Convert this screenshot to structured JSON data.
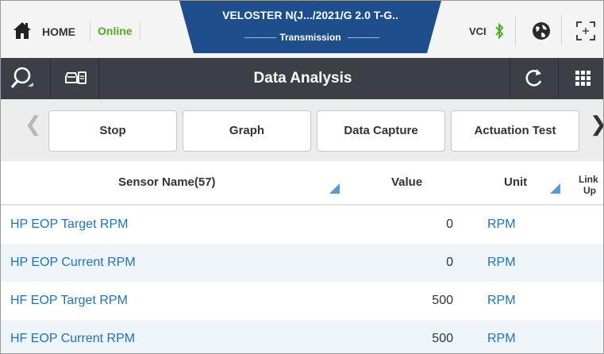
{
  "statusbar": {
    "home_label": "HOME",
    "online_label": "Online",
    "vehicle_title": "VELOSTER N(J.../2021/G 2.0 T-G..",
    "vehicle_system": "Transmission",
    "vci_label": "VCI",
    "icons": [
      "home-icon",
      "bluetooth-icon",
      "globe-icon",
      "fullscreen-icon"
    ]
  },
  "toolbar": {
    "title": "Data Analysis",
    "icons": [
      "search-icon",
      "vehicle-info-icon",
      "refresh-icon",
      "grid-menu-icon"
    ]
  },
  "actions": {
    "buttons": [
      "Stop",
      "Graph",
      "Data Capture",
      "Actuation Test"
    ]
  },
  "table": {
    "headers": {
      "sensor_name": "Sensor Name(57)",
      "value": "Value",
      "unit": "Unit",
      "link_up_line1": "Link",
      "link_up_line2": "Up"
    },
    "rows": [
      {
        "name": "HP EOP Target RPM",
        "value": "0",
        "unit": "RPM"
      },
      {
        "name": "HP EOP Current RPM",
        "value": "0",
        "unit": "RPM"
      },
      {
        "name": "HF EOP Target RPM",
        "value": "500",
        "unit": "RPM"
      },
      {
        "name": "HF EOP Current RPM",
        "value": "500",
        "unit": "RPM"
      }
    ]
  },
  "colors": {
    "accent_blue": "#1e73be",
    "header_navy": "#1f4e8c",
    "toolbar_dark": "#3d3f47",
    "online_green": "#4caf1f",
    "alt_row": "#eef4f8"
  }
}
